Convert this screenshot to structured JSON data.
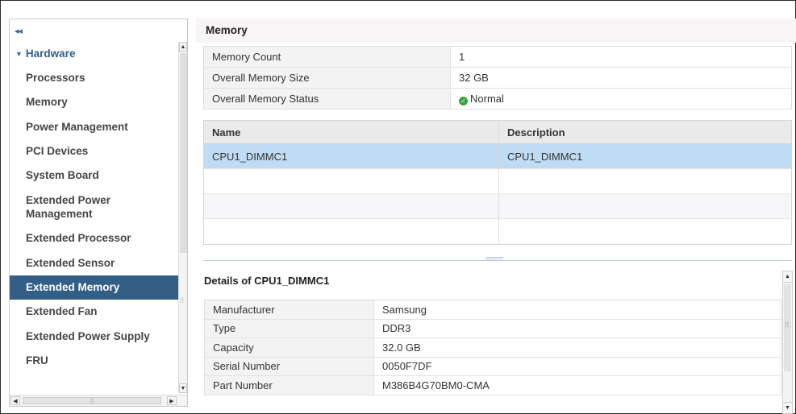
{
  "sidebar": {
    "collapse_glyph": "◂◂",
    "group_label": "Hardware",
    "items": [
      {
        "label": "Processors",
        "selected": false
      },
      {
        "label": "Memory",
        "selected": false
      },
      {
        "label": "Power Management",
        "selected": false
      },
      {
        "label": "PCI Devices",
        "selected": false
      },
      {
        "label": "System Board",
        "selected": false
      },
      {
        "label": "Extended Power Management",
        "selected": false
      },
      {
        "label": "Extended Processor",
        "selected": false
      },
      {
        "label": "Extended Sensor",
        "selected": false
      },
      {
        "label": "Extended Memory",
        "selected": true
      },
      {
        "label": "Extended Fan",
        "selected": false
      },
      {
        "label": "Extended Power Supply",
        "selected": false
      },
      {
        "label": "FRU",
        "selected": false
      }
    ]
  },
  "main": {
    "title": "Memory",
    "summary": [
      {
        "label": "Memory Count",
        "value": "1"
      },
      {
        "label": "Overall Memory Size",
        "value": "32 GB"
      },
      {
        "label": "Overall Memory Status",
        "value": "Normal",
        "status_icon": "check-circle-icon",
        "status_color": "#3ea33e"
      }
    ],
    "grid": {
      "columns": [
        "Name",
        "Description"
      ],
      "rows": [
        {
          "name": "CPU1_DIMMC1",
          "description": "CPU1_DIMMC1",
          "selected": true
        }
      ]
    },
    "details": {
      "title": "Details of CPU1_DIMMC1",
      "rows": [
        {
          "label": "Manufacturer",
          "value": "Samsung"
        },
        {
          "label": "Type",
          "value": "DDR3"
        },
        {
          "label": "Capacity",
          "value": "32.0 GB"
        },
        {
          "label": "Serial Number",
          "value": "0050F7DF"
        },
        {
          "label": "Part Number",
          "value": "M386B4G70BM0-CMA"
        }
      ]
    }
  },
  "colors": {
    "selected_nav_bg": "#335f86",
    "selected_row_bg": "#bfdcf4",
    "group_label": "#2f5f8f"
  }
}
